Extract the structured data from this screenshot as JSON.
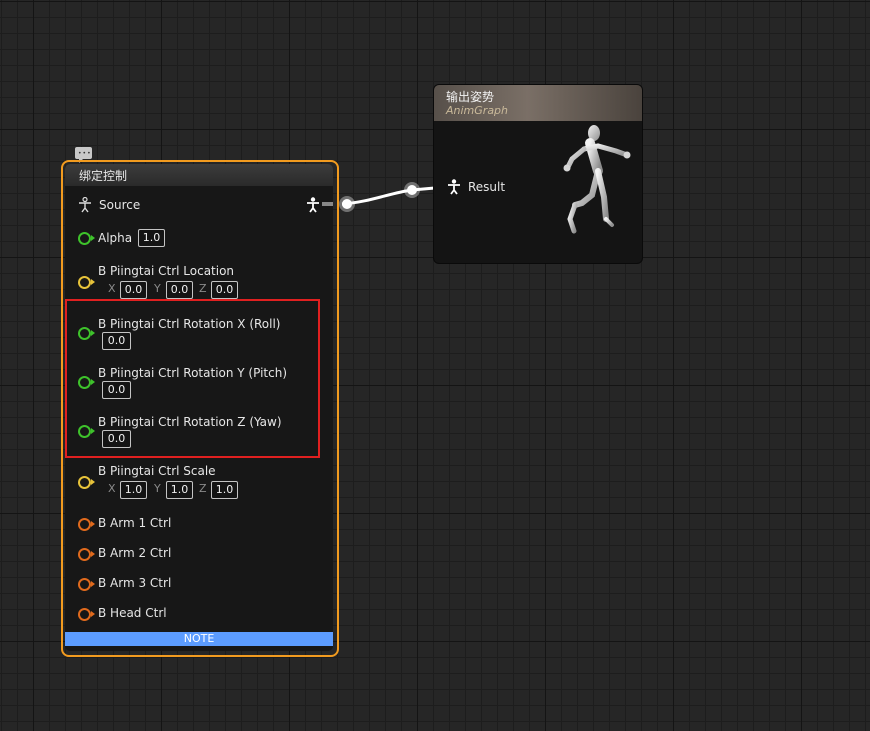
{
  "control_rig_node": {
    "title": "绑定控制",
    "source_label": "Source",
    "alpha": {
      "label": "Alpha",
      "value": "1.0"
    },
    "location": {
      "label": "B Piingtai Ctrl Location",
      "x_label": "X",
      "x": "0.0",
      "y_label": "Y",
      "y": "0.0",
      "z_label": "Z",
      "z": "0.0"
    },
    "rotation_x": {
      "label": "B Piingtai Ctrl Rotation X (Roll)",
      "value": "0.0"
    },
    "rotation_y": {
      "label": "B Piingtai Ctrl Rotation Y (Pitch)",
      "value": "0.0"
    },
    "rotation_z": {
      "label": "B Piingtai Ctrl Rotation Z (Yaw)",
      "value": "0.0"
    },
    "scale": {
      "label": "B Piingtai Ctrl Scale",
      "x_label": "X",
      "x": "1.0",
      "y_label": "Y",
      "y": "1.0",
      "z_label": "Z",
      "z": "1.0"
    },
    "arm1": "B Arm 1 Ctrl",
    "arm2": "B Arm 2 Ctrl",
    "arm3": "B Arm 3 Ctrl",
    "head": "B Head Ctrl",
    "note": "NOTE"
  },
  "output_pose_node": {
    "title": "输出姿势",
    "subtitle": "AnimGraph",
    "result_label": "Result"
  },
  "colors": {
    "selection_outline": "#f29b1f",
    "highlight_box": "#e02020",
    "float_pin": "#3ec22b",
    "vector_pin": "#e7c33a",
    "transform_pin": "#e06a1d",
    "note_bar": "#5c9cff"
  },
  "icons": {
    "comment": "comment-bubble-icon",
    "pose": "mannequin-pose-icon",
    "preview": "running-mannequin-preview"
  }
}
